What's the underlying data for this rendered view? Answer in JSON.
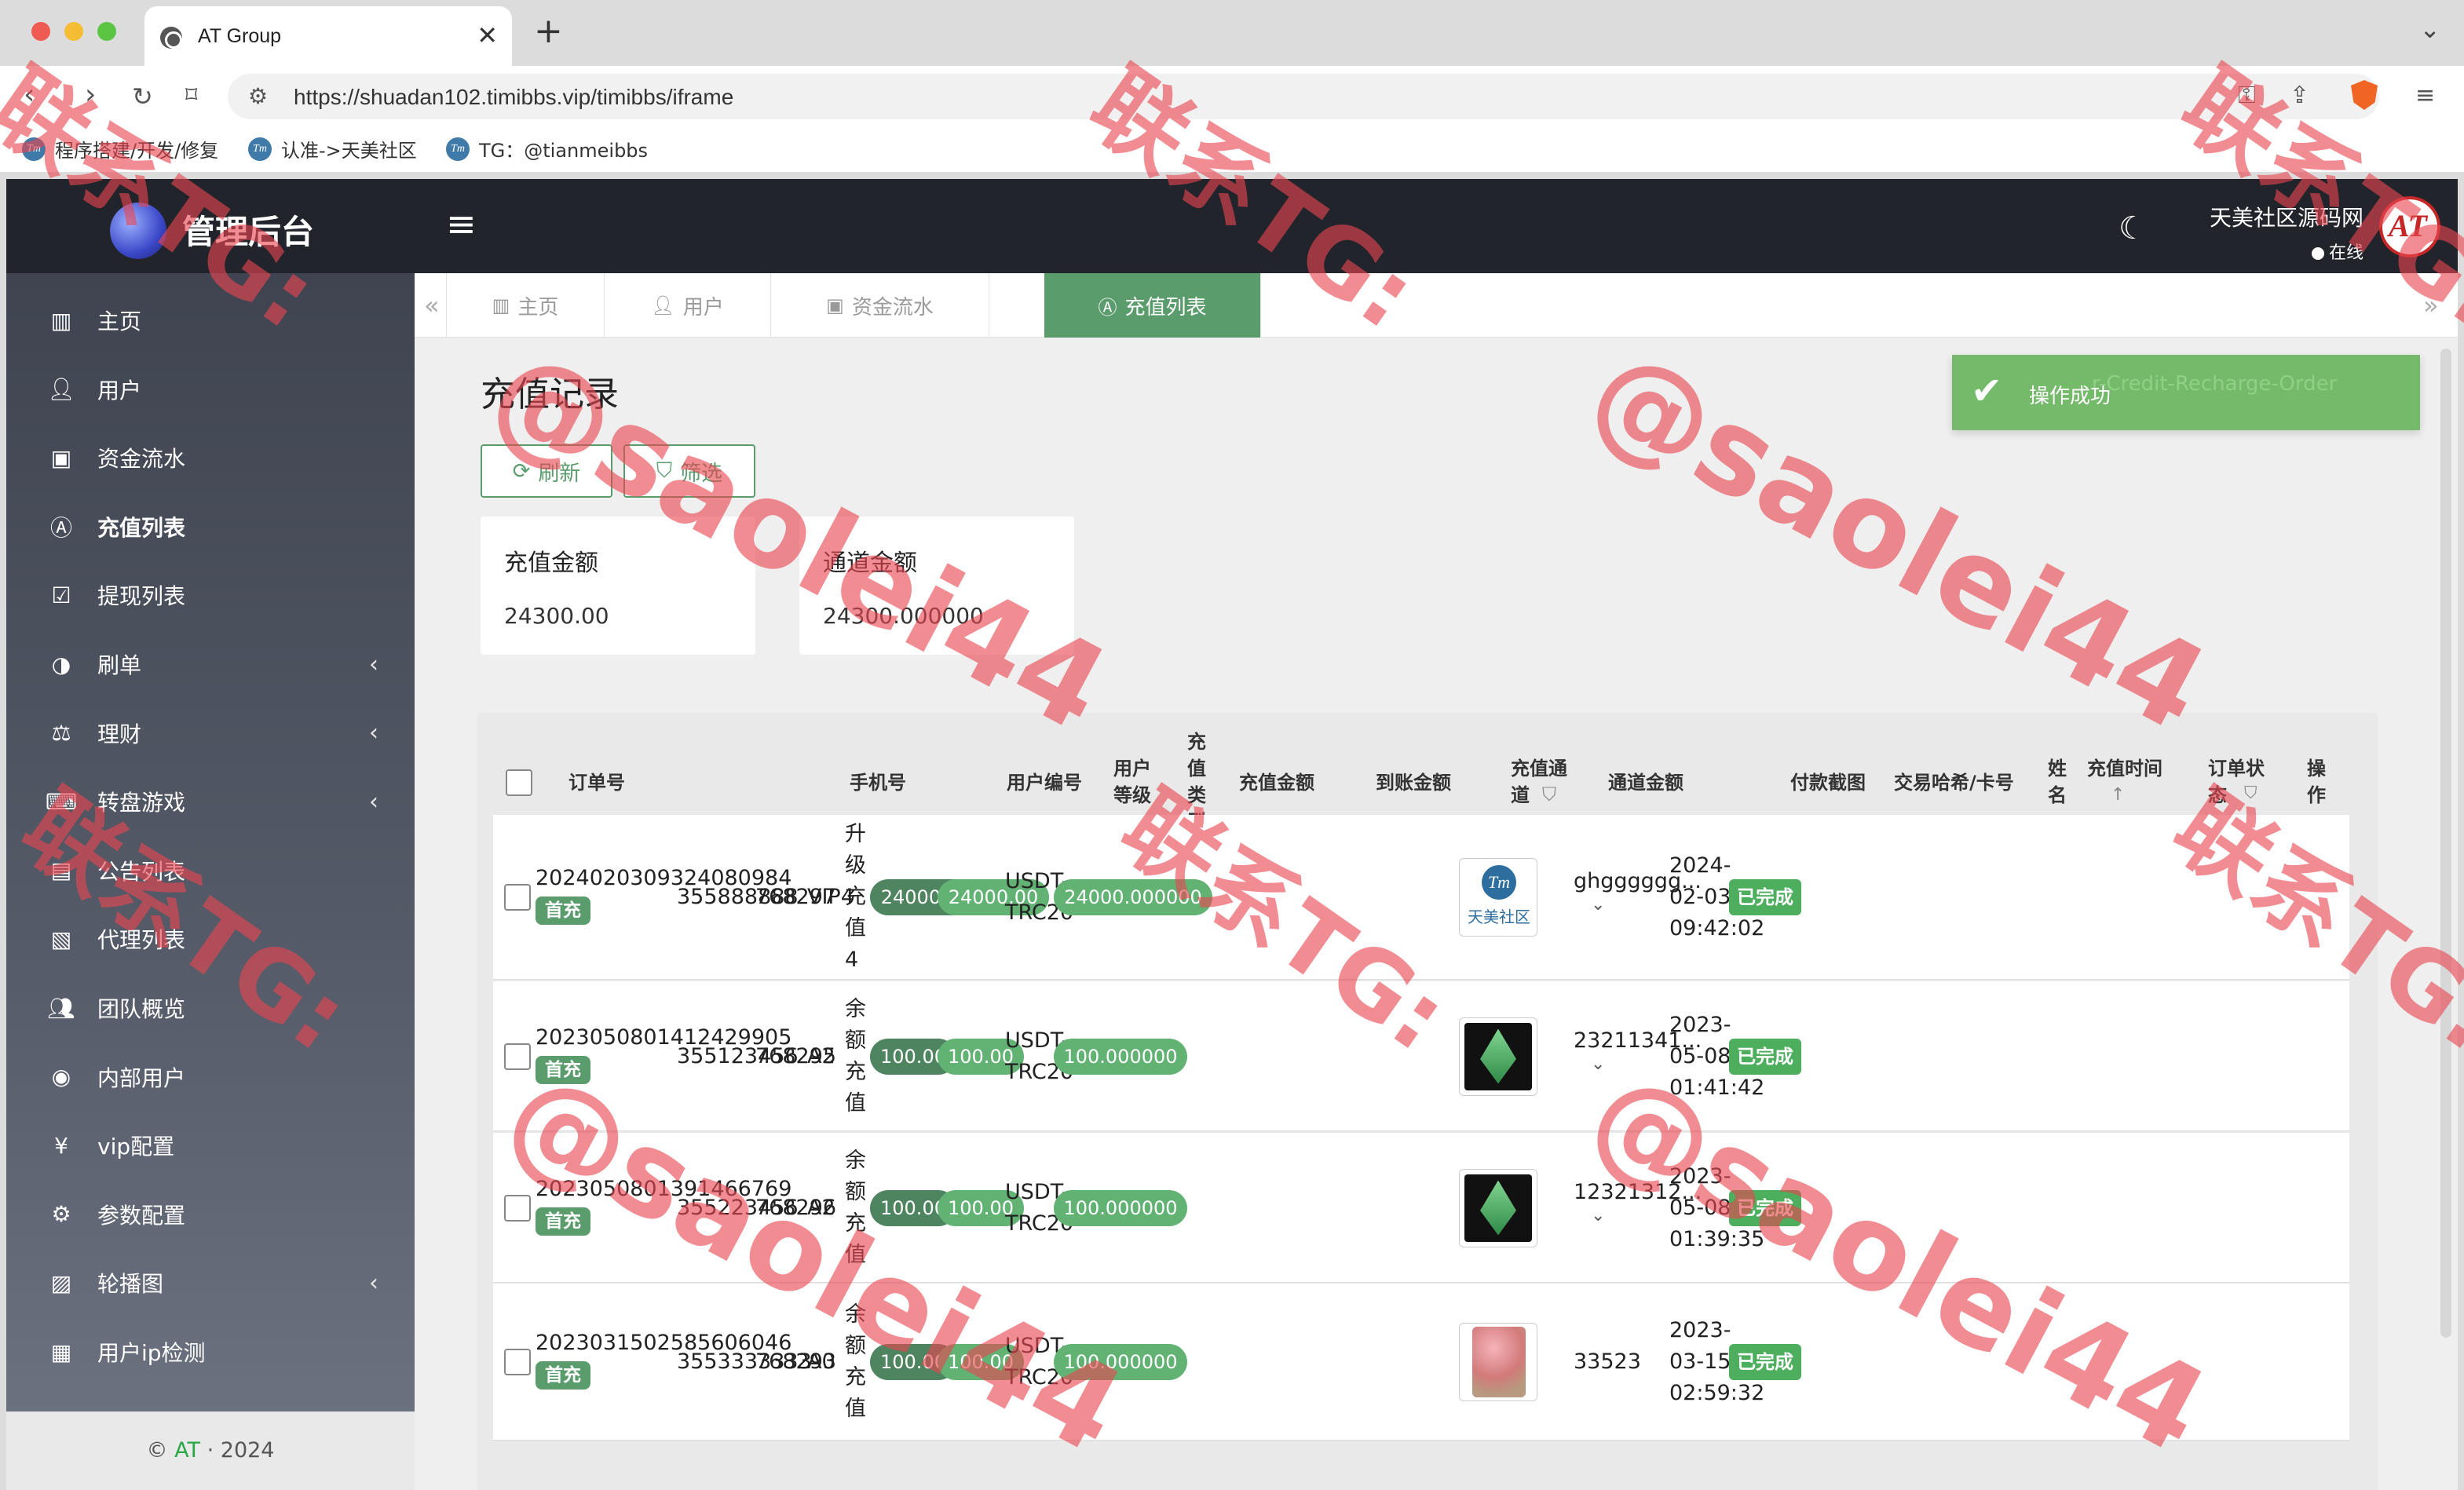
{
  "browser": {
    "tab_title": "AT Group",
    "url": "https://shuadan102.timibbs.vip/timibbs/iframe",
    "bookmarks": [
      "程序搭建/开发/修复",
      "认准->天美社区",
      "TG：@tianmeibbs"
    ]
  },
  "header": {
    "app_title": "管理后台",
    "user_name": "天美社区源码网",
    "user_status": "在线"
  },
  "sidebar": {
    "items": [
      {
        "label": "主页",
        "icon": "bar-chart-icon"
      },
      {
        "label": "用户",
        "icon": "user-icon"
      },
      {
        "label": "资金流水",
        "icon": "money-icon"
      },
      {
        "label": "充值列表",
        "icon": "recharge-icon"
      },
      {
        "label": "提现列表",
        "icon": "check-square-icon"
      },
      {
        "label": "刷单",
        "icon": "half-circle-icon"
      },
      {
        "label": "理财",
        "icon": "finance-icon"
      },
      {
        "label": "转盘游戏",
        "icon": "gamepad-icon"
      },
      {
        "label": "公告列表",
        "icon": "document-icon"
      },
      {
        "label": "代理列表",
        "icon": "id-card-icon"
      },
      {
        "label": "团队概览",
        "icon": "users-icon"
      },
      {
        "label": "内部用户",
        "icon": "user-circle-icon"
      },
      {
        "label": "vip配置",
        "icon": "yen-icon"
      },
      {
        "label": "参数配置",
        "icon": "cogs-icon"
      },
      {
        "label": "轮播图",
        "icon": "image-icon"
      },
      {
        "label": "用户ip检测",
        "icon": "id-badge-icon"
      }
    ],
    "footer_copyright": "©",
    "footer_brand": "AT",
    "footer_year": "2024"
  },
  "page_tabs": [
    {
      "label": "主页"
    },
    {
      "label": "用户"
    },
    {
      "label": "资金流水"
    },
    {
      "label": "充值列表"
    }
  ],
  "toast": {
    "message": "操作成功",
    "ghost_text": "r-Credit-Recharge-Order"
  },
  "page": {
    "title": "充值记录",
    "refresh_label": "刷新",
    "filter_label": "筛选"
  },
  "stats": [
    {
      "label": "充值金额",
      "value": "24300.00"
    },
    {
      "label": "通道金额",
      "value": "24300.000000"
    }
  ],
  "table": {
    "headers": {
      "order_no": "订单号",
      "phone": "手机号",
      "user_id": "用户编号",
      "level": "用户\n等级",
      "type": "充\n值\n类\n型",
      "amount": "充值金额",
      "arrive": "到账金额",
      "channel": "充值通\n道",
      "channel_amount": "通道金额",
      "screenshot": "付款截图",
      "hash": "交易哈希/卡号",
      "name": "姓\n名",
      "time": "充值时间",
      "status": "订单状\n态",
      "op": "操\n作"
    },
    "rows": [
      {
        "order_no": "2024020309324080984",
        "first_tag": "首充",
        "phone": "355888888",
        "user_id": "768297",
        "level": "VIP4",
        "type": "升\n级\n充\n值\n4",
        "amount": "24000.00",
        "arrive": "24000.00",
        "channel": "USDT-\nTRC20",
        "channel_amount": "24000.000000",
        "screenshot": "tianmei-logo",
        "hash": "ghgggggg...",
        "time": "2024-\n02-03\n09:42:02",
        "status": "已完成"
      },
      {
        "order_no": "2023050801412429905",
        "first_tag": "首充",
        "phone": "355123456",
        "user_id": "768295",
        "level": "A2",
        "type": "余\n额\n充\n值",
        "amount": "100.00",
        "arrive": "100.00",
        "channel": "USDT-\nTRC20",
        "channel_amount": "100.000000",
        "screenshot": "ethereum-logo",
        "hash": "23211341...",
        "time": "2023-\n05-08\n01:41:42",
        "status": "已完成"
      },
      {
        "order_no": "2023050801391466769",
        "first_tag": "首充",
        "phone": "355223456",
        "user_id": "768296",
        "level": "A2",
        "type": "余\n额\n充\n值",
        "amount": "100.00",
        "arrive": "100.00",
        "channel": "USDT-\nTRC20",
        "channel_amount": "100.000000",
        "screenshot": "ethereum-logo",
        "hash": "12321312...",
        "time": "2023-\n05-08\n01:39:35",
        "status": "已完成"
      },
      {
        "order_no": "2023031502585606046",
        "first_tag": "首充",
        "phone": "3553333333",
        "user_id": "768293",
        "level": "A0",
        "type": "余\n额\n充\n值",
        "amount": "100.00",
        "arrive": "100.00",
        "channel": "USDT-\nTRC20",
        "channel_amount": "100.000000",
        "screenshot": "flower-photo",
        "hash": "33523",
        "time": "2023-\n03-15\n02:59:32",
        "status": "已完成"
      }
    ]
  },
  "watermark": {
    "line1": "联系TG:",
    "line2": "@saolei44",
    "color": "#e84650"
  }
}
